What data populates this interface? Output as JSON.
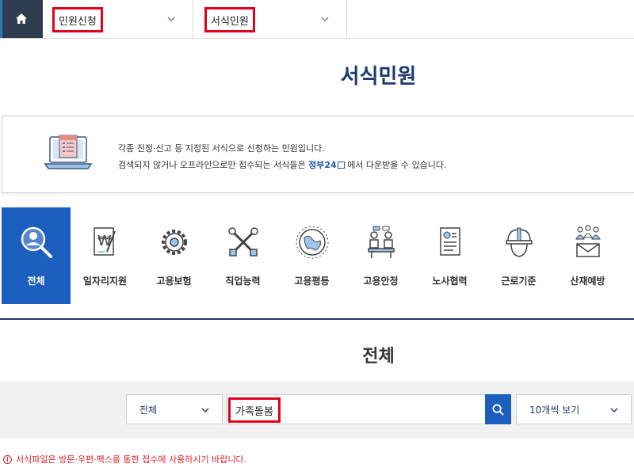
{
  "nav": {
    "home_icon": "home-icon",
    "crumb1": "민원신청",
    "crumb2": "서식민원"
  },
  "page": {
    "title": "서식민원",
    "section_title": "전체"
  },
  "info": {
    "line1": "각종 진정·신고 등 지정된 서식으로 신청하는 민원입니다.",
    "line2_before": "검색되지 않거나 오프라인으로만 접수되는 서식들은",
    "line2_link": "정부24",
    "line2_after": "에서 다운받을 수 있습니다."
  },
  "categories": [
    {
      "label": "전체",
      "icon": "search-person-icon",
      "active": true
    },
    {
      "label": "일자리지원",
      "icon": "document-pen-icon",
      "active": false
    },
    {
      "label": "고용보험",
      "icon": "gear-icon",
      "active": false
    },
    {
      "label": "직업능력",
      "icon": "tools-icon",
      "active": false
    },
    {
      "label": "고용평등",
      "icon": "globe-icon",
      "active": false
    },
    {
      "label": "고용안정",
      "icon": "meeting-icon",
      "active": false
    },
    {
      "label": "노사협력",
      "icon": "id-document-icon",
      "active": false
    },
    {
      "label": "근로기준",
      "icon": "hardhat-icon",
      "active": false
    },
    {
      "label": "산재예방",
      "icon": "people-mail-icon",
      "active": false
    }
  ],
  "search": {
    "category_value": "전체",
    "query_value": "가족돌봄",
    "page_size_value": "10개씩 보기"
  },
  "notice": {
    "text": "서식파일은 방문·우편·팩스를 통한 접수에 사용하시기 바랍니다."
  },
  "colors": {
    "primary_blue": "#1c5fbf",
    "title_navy": "#1b3c6b",
    "highlight_red": "#e2001a",
    "notice_red": "#d6242b"
  }
}
